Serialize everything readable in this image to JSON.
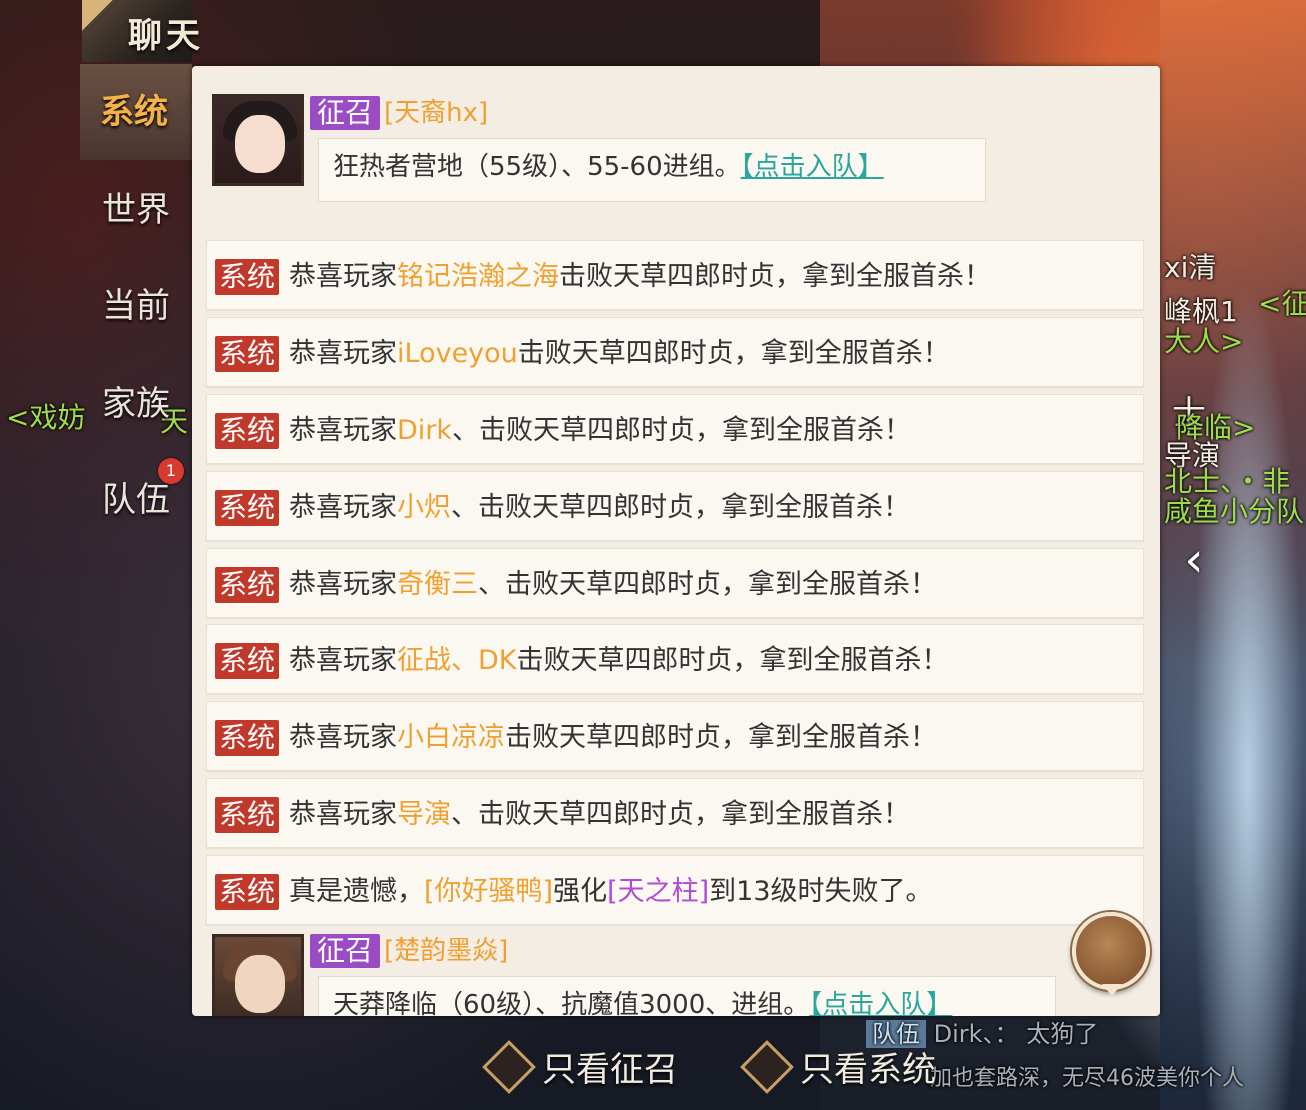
{
  "header": {
    "title": "聊天"
  },
  "tabs": [
    {
      "label": "系统",
      "active": true
    },
    {
      "label": "世界"
    },
    {
      "label": "当前"
    },
    {
      "label": "家族"
    },
    {
      "label": "队伍",
      "badge": "1"
    }
  ],
  "recruit_messages": [
    {
      "tag": "征召",
      "sender": "[天裔hx]",
      "text": "狂热者营地（55级）、55-60进组。",
      "link": "【点击入队】"
    },
    {
      "tag": "征召",
      "sender": "[楚韵墨焱]",
      "text": "天莽降临（60级）、抗魔值3000、进组。",
      "link": "【点击入队】"
    }
  ],
  "system_messages": [
    {
      "tag": "系统",
      "prefix": "恭喜玩家",
      "name": "铭记浩瀚之海",
      "suffix": "击败天草四郎时贞，拿到全服首杀！"
    },
    {
      "tag": "系统",
      "prefix": "恭喜玩家",
      "name": "iLoveyou",
      "suffix": "击败天草四郎时贞，拿到全服首杀！"
    },
    {
      "tag": "系统",
      "prefix": "恭喜玩家",
      "name": "Dirk",
      "suffix": "、击败天草四郎时贞，拿到全服首杀！"
    },
    {
      "tag": "系统",
      "prefix": "恭喜玩家",
      "name": "小炽",
      "suffix": "、击败天草四郎时贞，拿到全服首杀！"
    },
    {
      "tag": "系统",
      "prefix": "恭喜玩家",
      "name": "奇衡三",
      "suffix": "、击败天草四郎时贞，拿到全服首杀！"
    },
    {
      "tag": "系统",
      "prefix": "恭喜玩家",
      "name": "征战、DK",
      "suffix": "击败天草四郎时贞，拿到全服首杀！"
    },
    {
      "tag": "系统",
      "prefix": "恭喜玩家",
      "name": "小白凉凉",
      "suffix": "击败天草四郎时贞，拿到全服首杀！"
    },
    {
      "tag": "系统",
      "prefix": "恭喜玩家",
      "name": "导演",
      "suffix": "、击败天草四郎时贞，拿到全服首杀！"
    }
  ],
  "fail_message": {
    "tag": "系统",
    "prefix": "真是遗憾，",
    "player": "[你好骚鸭]",
    "mid": "强化",
    "item": "[天之柱]",
    "suffix": "到13级时失败了。"
  },
  "filters": {
    "recruit_only": "只看征召",
    "system_only": "只看系统"
  },
  "scene": {
    "left_tag": "<戏妨",
    "left_tag2": "天",
    "right_names": [
      "xi清",
      "峰枫1",
      "<征",
      "大人>",
      "士",
      "降临>",
      "导演",
      "北士、・非",
      "咸鱼小分队"
    ],
    "bottom_team": "队伍",
    "bottom_name": "Dirk、：",
    "bottom_msg": "太狗了",
    "bottom_msg2": "加也套路深，无尽46波美你个人"
  },
  "colors": {
    "system_tag": "#c0392b",
    "recruit_tag": "#9a4cc4",
    "player_name": "#f0a030",
    "item_name": "#b04ad8",
    "link": "#2aa69a"
  }
}
